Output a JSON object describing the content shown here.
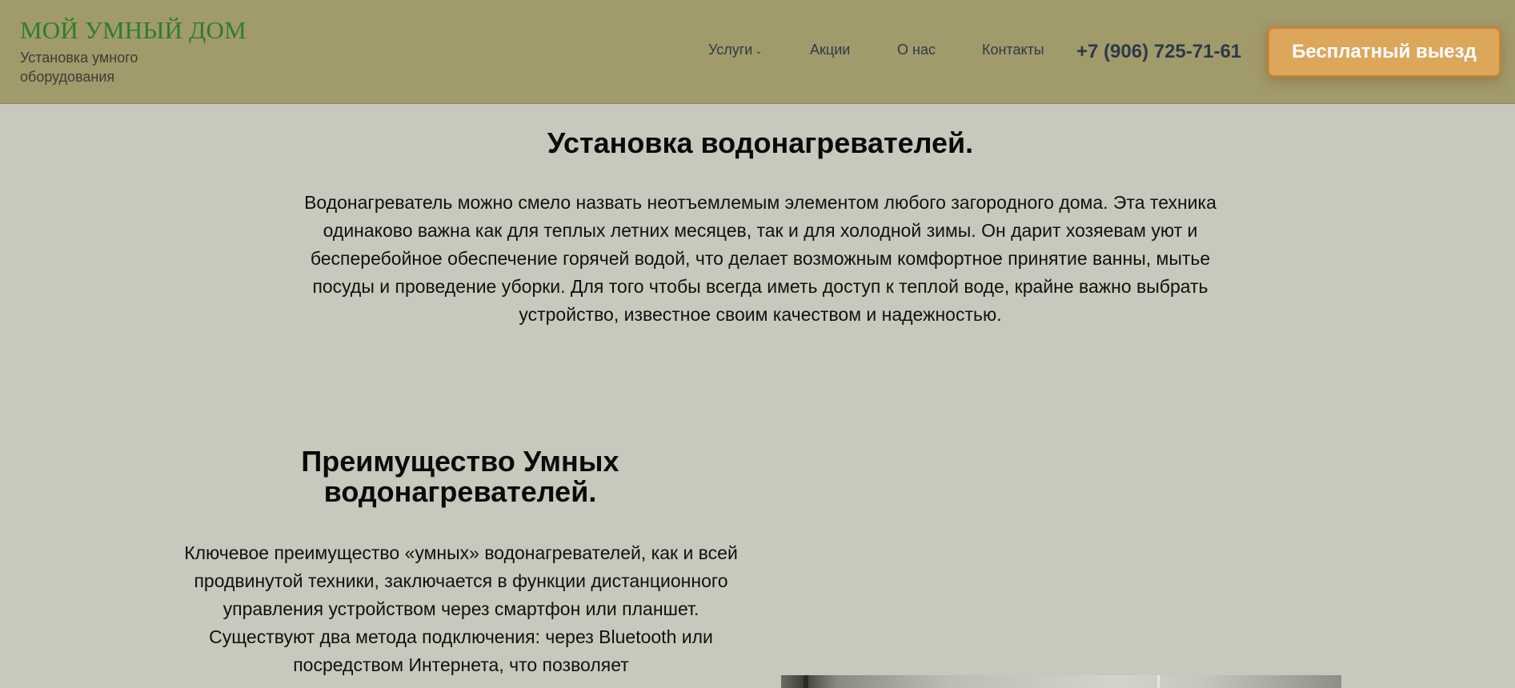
{
  "header": {
    "logo_title": "МОЙ УМНЫЙ ДОМ",
    "logo_subtitle": "Установка умного оборудования",
    "nav": {
      "services": "Услуги",
      "promotions": "Акции",
      "about": "О нас",
      "contacts": "Контакты"
    },
    "phone": "+7 (906) 725-71-61",
    "cta_label": "Бесплатный выезд"
  },
  "main": {
    "title": "Установка водонагревателей.",
    "intro": "Водонагреватель можно смело назвать неотъемлемым элементом любого загородного дома. Эта техника одинаково важна как для теплых летних месяцев, так и для холодной зимы. Он дарит хозяевам уют и бесперебойное обеспечение горячей водой, что делает возможным комфортное принятие ванны, мытье посуды и проведение уборки. Для того чтобы всегда иметь доступ к теплой воде, крайне важно выбрать устройство, известное своим качеством и надежностью.",
    "section_title": "Преимущество Умных водонагревателей.",
    "section_text": "Ключевое преимущество «умных» водонагревателей, как и всей продвинутой техники, заключается в функции дистанционного управления устройством через смартфон или планшет. Существуют два метода подключения: через Bluetooth или посредством Интернета, что позволяет"
  },
  "icons": {
    "services_dropdown": "chevron-down-icon"
  },
  "colors": {
    "header_bg": "#a19a6b",
    "page_bg": "#c6c9bb",
    "logo": "#2d7f24",
    "cta_bg": "#dca65b",
    "cta_border": "#d9802a"
  }
}
